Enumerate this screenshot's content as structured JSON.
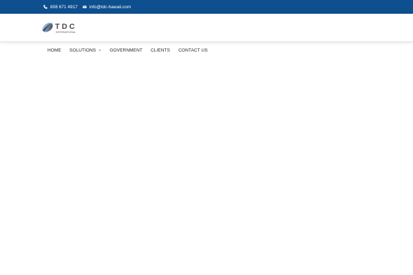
{
  "topbar": {
    "phone_icon": "phone-icon",
    "phone": "808 671 4917",
    "email_icon": "envelope-icon",
    "email": "info@tdc-hawaii.com",
    "background_color": "#0e4f8f"
  },
  "header": {
    "logo": {
      "brand": "TDC",
      "tagline": "INTERNATIONAL",
      "icon": "tdc-swoosh-logo"
    }
  },
  "nav": {
    "items": [
      {
        "label": "HOME"
      },
      {
        "label": "SOLUTIONS",
        "icon": "chevron-down-icon"
      },
      {
        "label": "GOVERNMENT"
      },
      {
        "label": "CLIENTS"
      },
      {
        "label": "CONTACT US"
      }
    ]
  },
  "colors": {
    "accent": "#0e4f8f",
    "logo_grey": "#5a5a5a",
    "nav_text": "#222222"
  }
}
